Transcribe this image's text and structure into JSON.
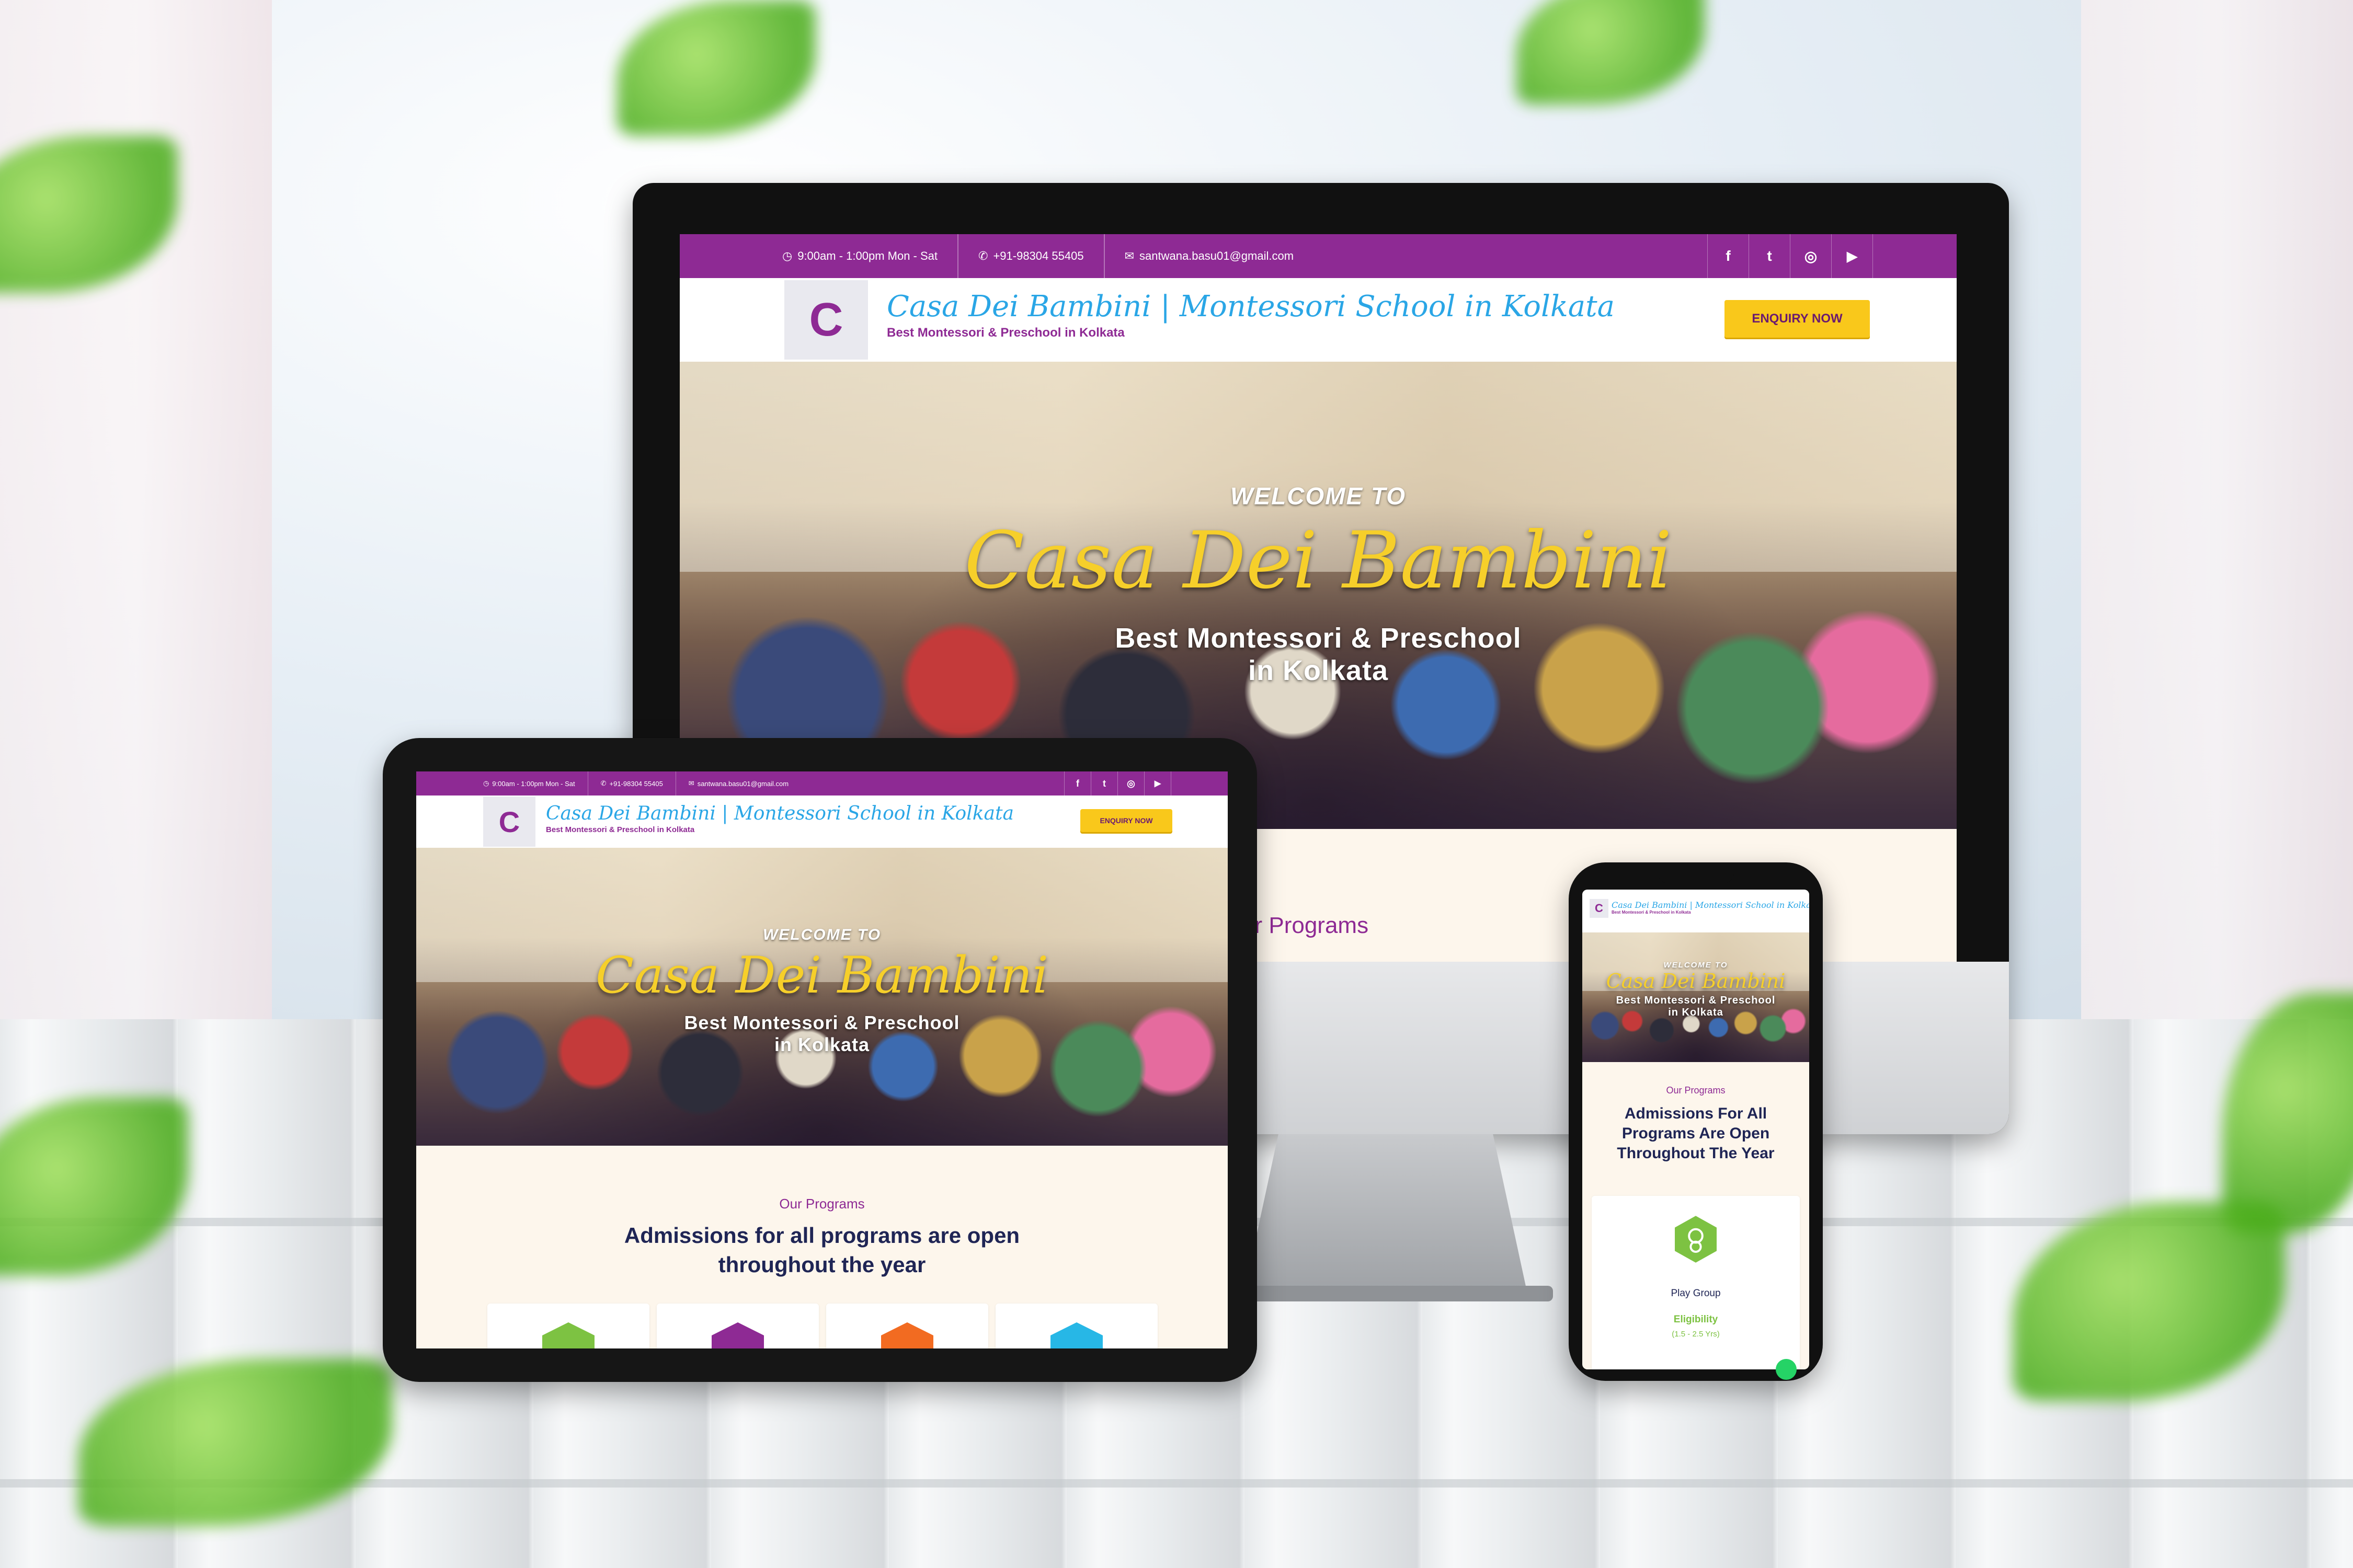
{
  "site": {
    "topbar": {
      "hours": "9:00am - 1:00pm Mon - Sat",
      "phone": "+91-98304 55405",
      "email_desktop": "santwana.basu01@gmail.com",
      "email_tablet": "santwana.basu01@gmail.com"
    },
    "brand": {
      "title": "Casa Dei Bambini | Montessori School in Kolkata",
      "subtitle": "Best Montessori & Preschool in Kolkata",
      "logo_letter": "C"
    },
    "enquiry_label": "ENQUIRY NOW",
    "hero": {
      "welcome": "WELCOME TO",
      "script_title": "Casa Dei Bambini",
      "sub_line1": "Best Montessori & Preschool",
      "sub_line2": "in Kolkata"
    },
    "programs": {
      "eyebrow_desktop": "ur Programs",
      "eyebrow": "Our Programs",
      "heading_tablet_line1": "Admissions for all programs are open",
      "heading_tablet_line2": "throughout the year",
      "heading_phone_line1": "Admissions For All",
      "heading_phone_line2": "Programs Are Open",
      "heading_phone_line3": "Throughout The Year"
    },
    "phone_card": {
      "title": "Play Group",
      "eligibility_label": "Eligibility",
      "eligibility_value": "(1.5 - 2.5 Yrs)"
    },
    "social_icons": [
      "facebook-icon",
      "twitter-icon",
      "instagram-icon",
      "youtube-icon"
    ],
    "social_glyphs": {
      "facebook": "f",
      "twitter": "t",
      "instagram": "◎",
      "youtube": "▶"
    },
    "program_colors": [
      "#7dc242",
      "#8e2a94",
      "#f26b21",
      "#27b7e6"
    ],
    "colors": {
      "topbar": "#8e2a94",
      "enquiry": "#f9c81b",
      "heading": "#1f2555",
      "script_yellow": "#f6cf2a",
      "brand_blue": "#2aa6e6"
    }
  }
}
